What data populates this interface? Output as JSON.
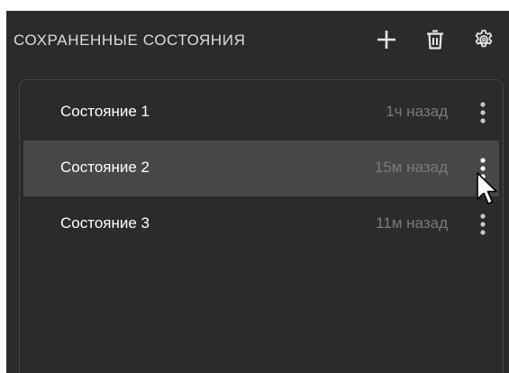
{
  "header": {
    "title": "СОХРАНЕННЫЕ СОСТОЯНИЯ",
    "icons": {
      "add": "plus-icon",
      "delete": "trash-icon",
      "settings": "gear-icon"
    }
  },
  "states": [
    {
      "name": "Состояние 1",
      "time": "1ч назад",
      "selected": false
    },
    {
      "name": "Состояние 2",
      "time": "15м назад",
      "selected": true
    },
    {
      "name": "Состояние 3",
      "time": "11м назад",
      "selected": false
    }
  ],
  "colors": {
    "panel_bg": "#2b2b2b",
    "selected_row_bg": "#474747",
    "text_primary": "#ffffff",
    "text_secondary": "#7a7a7a",
    "border": "#464646"
  }
}
